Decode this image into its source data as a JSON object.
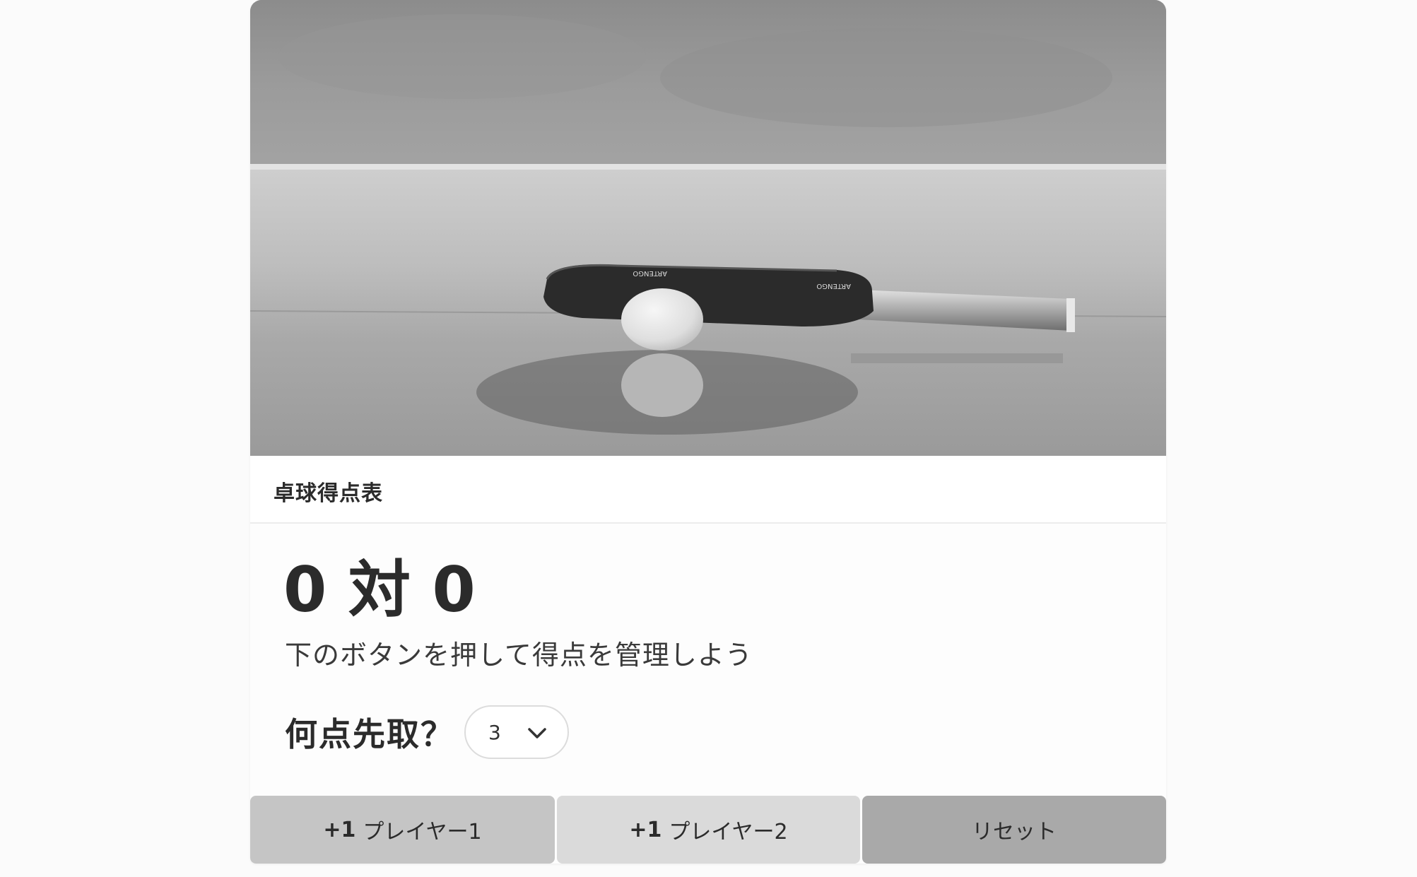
{
  "card": {
    "title": "卓球得点表"
  },
  "score": {
    "player1": "0",
    "separator": "対",
    "player2": "0"
  },
  "subtitle": "下のボタンを押して得点を管理しよう",
  "goal": {
    "label": "何点先取？",
    "selected_value": "3"
  },
  "buttons": {
    "player1_prefix": "+1",
    "player1_label": "プレイヤー1",
    "player2_prefix": "+1",
    "player2_label": "プレイヤー2",
    "reset_label": "リセット"
  },
  "hero_image": {
    "paddle_brand": "ARTENGO"
  },
  "icons": {
    "select_chevron": "chevron-down-icon"
  }
}
